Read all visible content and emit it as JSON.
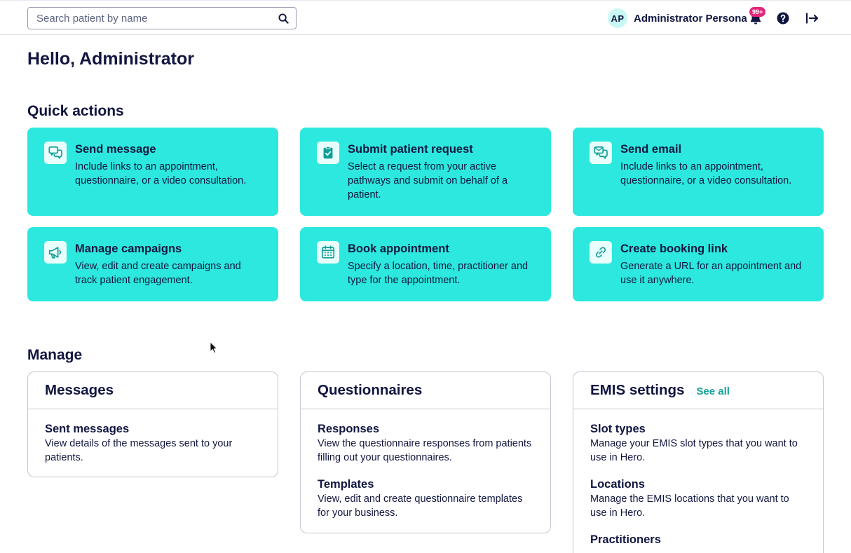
{
  "search": {
    "placeholder": "Search patient by name",
    "icon": "search-icon"
  },
  "user": {
    "initials": "AP",
    "name": "Administrator Persona"
  },
  "notifications": {
    "badge": "99+",
    "icon": "bell-icon"
  },
  "greeting": "Hello, Administrator",
  "quick_actions": {
    "title": "Quick actions",
    "cards": [
      {
        "icon": "chat-bubbles-icon",
        "title": "Send message",
        "desc": "Include links to an appointment, questionnaire, or a video consultation."
      },
      {
        "icon": "clipboard-check-icon",
        "title": "Submit patient request",
        "desc": "Select a request from your active pathways and submit on behalf of a patient."
      },
      {
        "icon": "email-bubbles-icon",
        "title": "Send email",
        "desc": "Include links to an appointment, questionnaire, or a video consultation."
      },
      {
        "icon": "megaphone-icon",
        "title": "Manage campaigns",
        "desc": "View, edit and create campaigns and track patient engagement."
      },
      {
        "icon": "calendar-icon",
        "title": "Book appointment",
        "desc": "Specify a location, time, practitioner and type for the appointment."
      },
      {
        "icon": "link-icon",
        "title": "Create booking link",
        "desc": "Generate a URL for an appointment and use it anywhere."
      }
    ]
  },
  "manage": {
    "title": "Manage",
    "panels": [
      {
        "title": "Messages",
        "items": [
          {
            "title": "Sent messages",
            "desc": "View details of the messages sent to your patients."
          }
        ]
      },
      {
        "title": "Questionnaires",
        "items": [
          {
            "title": "Responses",
            "desc": "View the questionnaire responses from patients filling out your questionnaires."
          },
          {
            "title": "Templates",
            "desc": "View, edit and create questionnaire templates for your business."
          }
        ]
      },
      {
        "title": "EMIS settings",
        "see_all": "See all",
        "items": [
          {
            "title": "Slot types",
            "desc": "Manage your EMIS slot types that you want to use in Hero."
          },
          {
            "title": "Locations",
            "desc": "Manage the EMIS locations that you want to use in Hero."
          },
          {
            "title": "Practitioners",
            "desc": ""
          }
        ]
      }
    ]
  },
  "colors": {
    "accent": "#2de8de",
    "navy": "#111640",
    "badge": "#e2287a",
    "link": "#14a39a"
  }
}
